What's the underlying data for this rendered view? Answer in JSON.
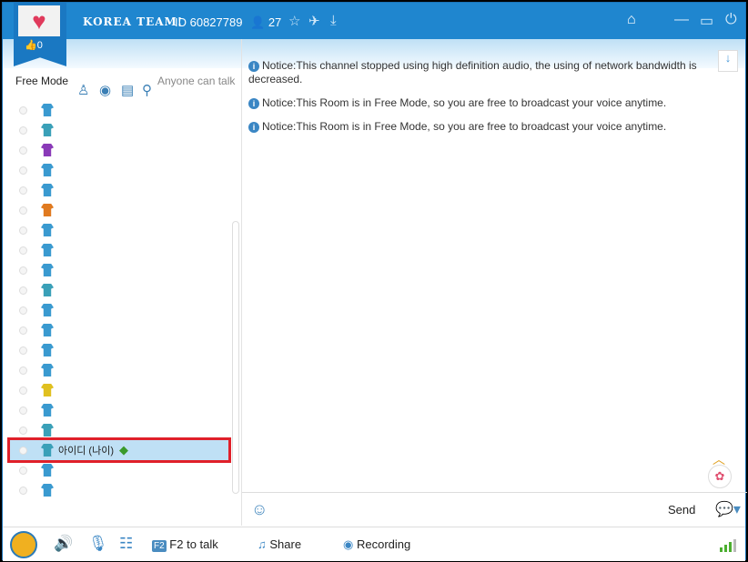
{
  "header": {
    "room_name": "KOREA TEAM!",
    "room_id": "ID 60827789",
    "user_count": "27",
    "likes": "0"
  },
  "sidebar": {
    "mode": "Free Mode",
    "talk_rule": "Anyone can talk",
    "members": [
      {
        "color": "#3a9ad0"
      },
      {
        "color": "#3aa0b8"
      },
      {
        "color": "#8a3ab8"
      },
      {
        "color": "#3a9ad0"
      },
      {
        "color": "#3a9ad0"
      },
      {
        "color": "#e07a20"
      },
      {
        "color": "#3a9ad0"
      },
      {
        "color": "#3a9ad0"
      },
      {
        "color": "#3a9ad0"
      },
      {
        "color": "#3aa0b8"
      },
      {
        "color": "#3a9ad0"
      },
      {
        "color": "#3a9ad0"
      },
      {
        "color": "#3a9ad0"
      },
      {
        "color": "#3a9ad0"
      },
      {
        "color": "#e0c020"
      },
      {
        "color": "#3a9ad0"
      },
      {
        "color": "#3aa0b8"
      },
      {
        "color": "#3aa0b8",
        "name": "아이디 (나이)",
        "selected": true
      },
      {
        "color": "#3a9ad0"
      },
      {
        "color": "#3a9ad0"
      }
    ]
  },
  "messages": [
    "Notice:This channel stopped using high definition audio, the using of network bandwidth is decreased.",
    "Notice:This Room is in Free Mode, so you are free to broadcast your voice anytime.",
    "Notice:This Room is in Free Mode, so you are free to broadcast your voice anytime."
  ],
  "input": {
    "send_label": "Send"
  },
  "bottom": {
    "f2_key": "F2",
    "f2_label": "F2 to talk",
    "share_label": "Share",
    "recording_label": "Recording"
  }
}
